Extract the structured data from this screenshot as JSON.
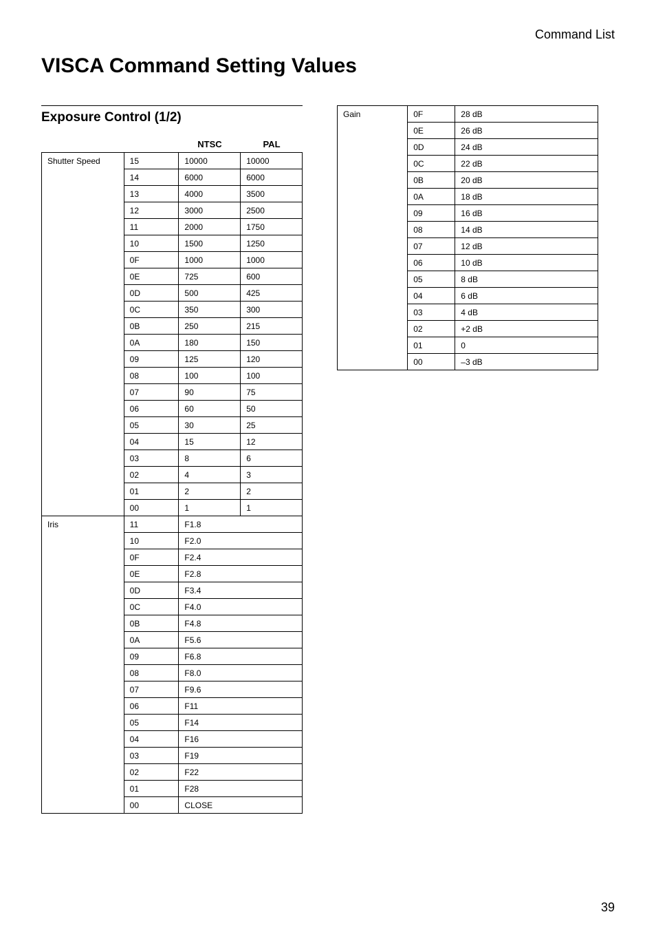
{
  "header": {
    "breadcrumb": "Command List"
  },
  "title": "VISCA Command Setting Values",
  "section": {
    "title": "Exposure Control (1/2)"
  },
  "columns": {
    "param": "",
    "code": "",
    "ntsc": "NTSC",
    "pal": "PAL"
  },
  "shutter": {
    "label": "Shutter Speed",
    "rows": [
      {
        "code": "15",
        "ntsc": "10000",
        "pal": "10000"
      },
      {
        "code": "14",
        "ntsc": "6000",
        "pal": "6000"
      },
      {
        "code": "13",
        "ntsc": "4000",
        "pal": "3500"
      },
      {
        "code": "12",
        "ntsc": "3000",
        "pal": "2500"
      },
      {
        "code": "11",
        "ntsc": "2000",
        "pal": "1750"
      },
      {
        "code": "10",
        "ntsc": "1500",
        "pal": "1250"
      },
      {
        "code": "0F",
        "ntsc": "1000",
        "pal": "1000"
      },
      {
        "code": "0E",
        "ntsc": "725",
        "pal": "600"
      },
      {
        "code": "0D",
        "ntsc": "500",
        "pal": "425"
      },
      {
        "code": "0C",
        "ntsc": "350",
        "pal": "300"
      },
      {
        "code": "0B",
        "ntsc": "250",
        "pal": "215"
      },
      {
        "code": "0A",
        "ntsc": "180",
        "pal": "150"
      },
      {
        "code": "09",
        "ntsc": "125",
        "pal": "120"
      },
      {
        "code": "08",
        "ntsc": "100",
        "pal": "100"
      },
      {
        "code": "07",
        "ntsc": "90",
        "pal": "75"
      },
      {
        "code": "06",
        "ntsc": "60",
        "pal": "50"
      },
      {
        "code": "05",
        "ntsc": "30",
        "pal": "25"
      },
      {
        "code": "04",
        "ntsc": "15",
        "pal": "12"
      },
      {
        "code": "03",
        "ntsc": "8",
        "pal": "6"
      },
      {
        "code": "02",
        "ntsc": "4",
        "pal": "3"
      },
      {
        "code": "01",
        "ntsc": "2",
        "pal": "2"
      },
      {
        "code": "00",
        "ntsc": "1",
        "pal": "1"
      }
    ]
  },
  "iris": {
    "label": "Iris",
    "rows": [
      {
        "code": "11",
        "val": "F1.8"
      },
      {
        "code": "10",
        "val": "F2.0"
      },
      {
        "code": "0F",
        "val": "F2.4"
      },
      {
        "code": "0E",
        "val": "F2.8"
      },
      {
        "code": "0D",
        "val": "F3.4"
      },
      {
        "code": "0C",
        "val": "F4.0"
      },
      {
        "code": "0B",
        "val": "F4.8"
      },
      {
        "code": "0A",
        "val": "F5.6"
      },
      {
        "code": "09",
        "val": "F6.8"
      },
      {
        "code": "08",
        "val": "F8.0"
      },
      {
        "code": "07",
        "val": "F9.6"
      },
      {
        "code": "06",
        "val": "F11"
      },
      {
        "code": "05",
        "val": "F14"
      },
      {
        "code": "04",
        "val": "F16"
      },
      {
        "code": "03",
        "val": "F19"
      },
      {
        "code": "02",
        "val": "F22"
      },
      {
        "code": "01",
        "val": "F28"
      },
      {
        "code": "00",
        "val": "CLOSE"
      }
    ]
  },
  "gain": {
    "label": "Gain",
    "rows": [
      {
        "code": "0F",
        "val": "28 dB"
      },
      {
        "code": "0E",
        "val": "26 dB"
      },
      {
        "code": "0D",
        "val": "24 dB"
      },
      {
        "code": "0C",
        "val": "22 dB"
      },
      {
        "code": "0B",
        "val": "20 dB"
      },
      {
        "code": "0A",
        "val": "18 dB"
      },
      {
        "code": "09",
        "val": "16 dB"
      },
      {
        "code": "08",
        "val": "14 dB"
      },
      {
        "code": "07",
        "val": "12 dB"
      },
      {
        "code": "06",
        "val": "10 dB"
      },
      {
        "code": "05",
        "val": "8 dB"
      },
      {
        "code": "04",
        "val": "6 dB"
      },
      {
        "code": "03",
        "val": "4 dB"
      },
      {
        "code": "02",
        "val": "+2 dB"
      },
      {
        "code": "01",
        "val": "0"
      },
      {
        "code": "00",
        "val": "–3 dB"
      }
    ]
  },
  "page": "39"
}
